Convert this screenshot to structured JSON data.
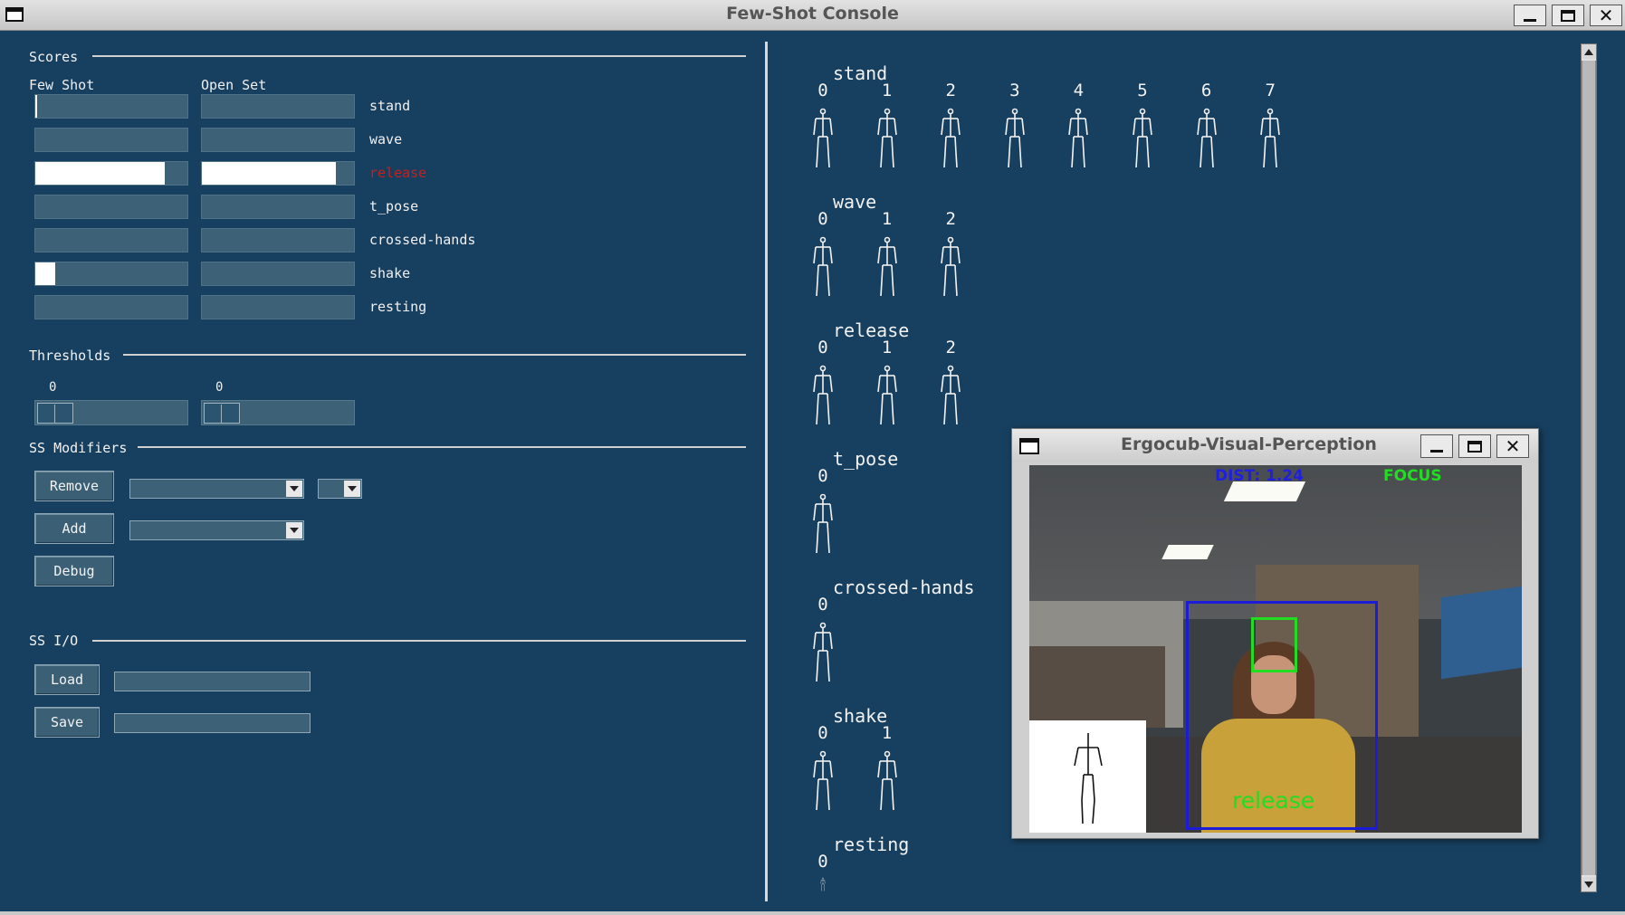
{
  "window": {
    "title": "Few-Shot Console"
  },
  "scores": {
    "section_title": "Scores",
    "col_few_shot": "Few Shot",
    "col_open_set": "Open Set",
    "rows": [
      {
        "label": "stand",
        "few_shot": 0.01,
        "open_set": 0.0
      },
      {
        "label": "wave",
        "few_shot": 0.0,
        "open_set": 0.0
      },
      {
        "label": "release",
        "few_shot": 0.84,
        "open_set": 0.87,
        "active": true
      },
      {
        "label": "t_pose",
        "few_shot": 0.0,
        "open_set": 0.0
      },
      {
        "label": "crossed-hands",
        "few_shot": 0.0,
        "open_set": 0.0
      },
      {
        "label": "shake",
        "few_shot": 0.13,
        "open_set": 0.0
      },
      {
        "label": "resting",
        "few_shot": 0.0,
        "open_set": 0.0
      }
    ],
    "active_color": "#c81e1e"
  },
  "thresholds": {
    "section_title": "Thresholds",
    "few_shot_value": "0",
    "open_set_value": "0"
  },
  "ss_modifiers": {
    "section_title": "SS Modifiers",
    "remove_label": "Remove",
    "add_label": "Add",
    "debug_label": "Debug"
  },
  "ss_io": {
    "section_title": "SS I/O",
    "load_label": "Load",
    "save_label": "Save"
  },
  "support_set": [
    {
      "name": "stand",
      "indices": [
        "0",
        "1",
        "2",
        "3",
        "4",
        "5",
        "6",
        "7"
      ]
    },
    {
      "name": "wave",
      "indices": [
        "0",
        "1",
        "2"
      ]
    },
    {
      "name": "release",
      "indices": [
        "0",
        "1",
        "2"
      ]
    },
    {
      "name": "t_pose",
      "indices": [
        "0"
      ]
    },
    {
      "name": "crossed-hands",
      "indices": [
        "0"
      ]
    },
    {
      "name": "shake",
      "indices": [
        "0",
        "1"
      ]
    },
    {
      "name": "resting",
      "indices": [
        "0"
      ]
    }
  ],
  "perception_window": {
    "title": "Ergocub-Visual-Perception",
    "distance": "DIST: 1.24",
    "focus": "FOCUS",
    "action": "release",
    "bbox_color": "#1b1bd8",
    "focus_color": "#22dd22"
  },
  "icons": [
    "window-icon",
    "minimize-icon",
    "maximize-icon",
    "close-icon",
    "chevron-down-icon",
    "scroll-up-icon",
    "scroll-down-icon",
    "skeleton-icon"
  ]
}
